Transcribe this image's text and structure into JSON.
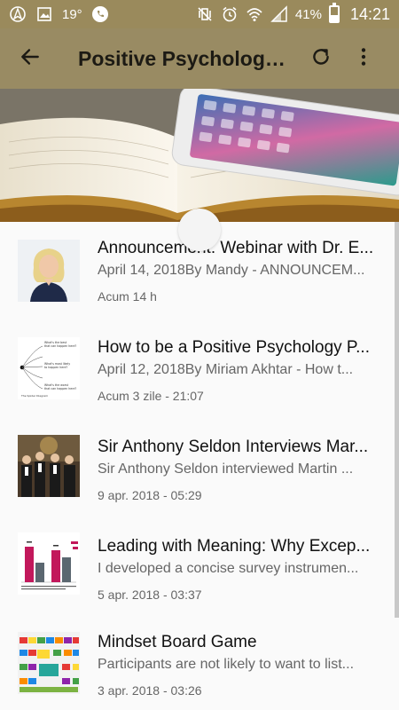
{
  "status_bar": {
    "temperature": "19°",
    "battery": "41%",
    "battery_level": 0.41,
    "time": "14:21"
  },
  "app_bar": {
    "title": "Positive Psycholog…",
    "back_icon": "back-arrow-icon",
    "refresh_icon": "refresh-icon",
    "menu_icon": "more-vert-icon"
  },
  "list": {
    "items": [
      {
        "title": "Announcement: Webinar with Dr. E...",
        "subtitle": "April 14, 2018By Mandy - ANNOUNCEM...",
        "meta": "Acum 14 h"
      },
      {
        "title": "How to be a Positive Psychology P...",
        "subtitle": "April 12, 2018By Miriam Akhtar - How t...",
        "meta": "Acum 3 zile - 21:07"
      },
      {
        "title": "Sir Anthony Seldon Interviews Mar...",
        "subtitle": "Sir Anthony Seldon interviewed Martin ...",
        "meta": "9 apr. 2018 - 05:29"
      },
      {
        "title": "Leading with Meaning: Why Excep...",
        "subtitle": "I developed a concise survey instrumen...",
        "meta": "5 apr. 2018 - 03:37"
      },
      {
        "title": "Mindset Board Game",
        "subtitle": "Participants are not likely to want to list...",
        "meta": "3 apr. 2018 - 03:26"
      }
    ]
  },
  "thumb2_diagram": {
    "line1a": "What's the best",
    "line1b": "that can happen here?",
    "line2a": "What's most likely",
    "line2b": "to happen here?",
    "line3a": "What's the worst",
    "line3b": "that can happen here?",
    "caption": "The Spider Diagram"
  },
  "colors": {
    "status_bar": "#9a8a5c",
    "app_bar": "#998b63"
  }
}
